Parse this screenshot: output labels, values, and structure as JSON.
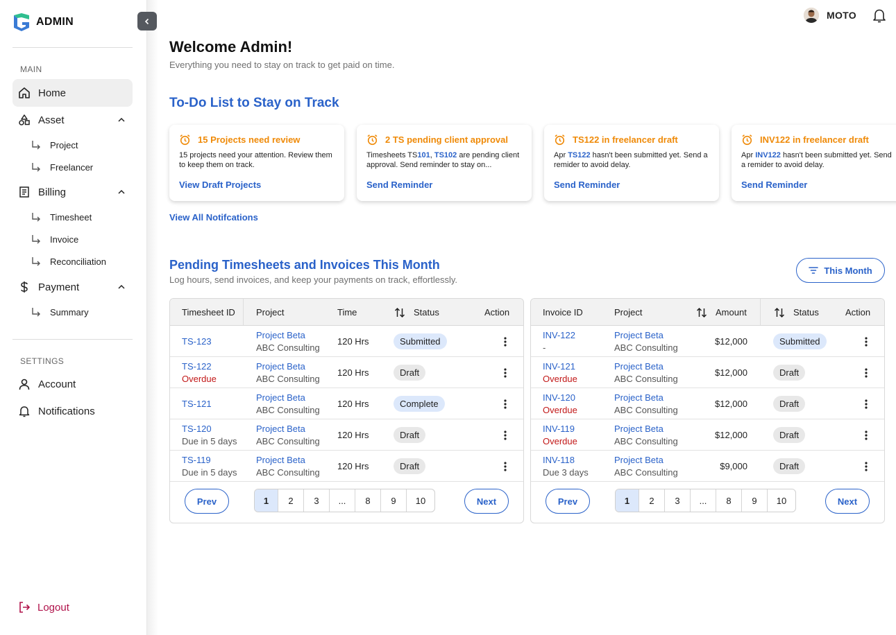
{
  "brand": {
    "name": "ADMIN"
  },
  "sidebar": {
    "main_label": "MAIN",
    "settings_label": "SETTINGS",
    "home": "Home",
    "asset": "Asset",
    "asset_items": [
      "Project",
      "Freelancer"
    ],
    "billing": "Billing",
    "billing_items": [
      "Timesheet",
      "Invoice",
      "Reconciliation"
    ],
    "payment": "Payment",
    "payment_items": [
      "Summary"
    ],
    "account": "Account",
    "notifications": "Notifications",
    "logout": "Logout"
  },
  "topbar": {
    "user_name": "MOTO"
  },
  "welcome": {
    "title": "Welcome Admin!",
    "subtitle": "Everything you need to stay on track to get paid on time."
  },
  "todo": {
    "title": "To-Do List to Stay on Track",
    "view_all": "View All Notifcations",
    "cards": [
      {
        "title": "15 Projects need review",
        "body_pre": "15 projects need your attention. Review them to keep them on track.",
        "hl1": "",
        "mid": "",
        "hl2": "",
        "body_post": "",
        "action": "View Draft Projects"
      },
      {
        "title": "2 TS pending client approval",
        "body_pre": "Timesheets TS",
        "hl1": "101",
        "mid": ", ",
        "hl2": "TS102",
        "body_post": " are pending client approval. Send reminder to stay on...",
        "action": "Send Reminder"
      },
      {
        "title": "TS122 in freelancer draft",
        "body_pre": "Apr ",
        "hl1": "TS122",
        "mid": "",
        "hl2": "",
        "body_post": " hasn't been submitted yet. Send a remider to avoid delay.",
        "action": "Send Reminder"
      },
      {
        "title": "INV122 in freelancer draft",
        "body_pre": "Apr ",
        "hl1": "INV122",
        "mid": "",
        "hl2": "",
        "body_post": " hasn't been submitted yet. Send a remider to avoid delay.",
        "action": "Send Reminder"
      }
    ]
  },
  "pending": {
    "title": "Pending Timesheets and Invoices This Month",
    "subtitle": "Log hours, send invoices, and keep your payments on track, effortlessly.",
    "filter_label": "This Month"
  },
  "timesheets": {
    "headers": {
      "id": "Timesheet ID",
      "project": "Project",
      "time": "Time",
      "status": "Status",
      "action": "Action"
    },
    "rows": [
      {
        "id": "TS-123",
        "note": "",
        "note_type": "none",
        "project": "Project Beta",
        "client": "ABC Consulting",
        "time": "120 Hrs",
        "status": "Submitted",
        "status_color": "blue"
      },
      {
        "id": "TS-122",
        "note": "Overdue",
        "note_type": "overdue",
        "project": "Project Beta",
        "client": "ABC Consulting",
        "time": "120 Hrs",
        "status": "Draft",
        "status_color": "gray"
      },
      {
        "id": "TS-121",
        "note": "",
        "note_type": "none",
        "project": "Project Beta",
        "client": "ABC Consulting",
        "time": "120 Hrs",
        "status": "Complete",
        "status_color": "blue"
      },
      {
        "id": "TS-120",
        "note": "Due in 5 days",
        "note_type": "normal",
        "project": "Project Beta",
        "client": "ABC Consulting",
        "time": "120 Hrs",
        "status": "Draft",
        "status_color": "gray"
      },
      {
        "id": "TS-119",
        "note": "Due in 5 days",
        "note_type": "normal",
        "project": "Project Beta",
        "client": "ABC Consulting",
        "time": "120 Hrs",
        "status": "Draft",
        "status_color": "gray"
      }
    ],
    "pager": {
      "prev": "Prev",
      "next": "Next",
      "pages": [
        "1",
        "2",
        "3",
        "...",
        "8",
        "9",
        "10"
      ],
      "current": "1"
    }
  },
  "invoices": {
    "headers": {
      "id": "Invoice ID",
      "project": "Project",
      "amount": "Amount",
      "status": "Status",
      "action": "Action"
    },
    "rows": [
      {
        "id": "INV-122",
        "note": "-",
        "note_type": "normal",
        "project": "Project Beta",
        "client": "ABC Consulting",
        "amount": "$12,000",
        "status": "Submitted",
        "status_color": "blue"
      },
      {
        "id": "INV-121",
        "note": "Overdue",
        "note_type": "overdue",
        "project": "Project Beta",
        "client": "ABC Consulting",
        "amount": "$12,000",
        "status": "Draft",
        "status_color": "gray"
      },
      {
        "id": "INV-120",
        "note": "Overdue",
        "note_type": "overdue",
        "project": "Project Beta",
        "client": "ABC Consulting",
        "amount": "$12,000",
        "status": "Draft",
        "status_color": "gray"
      },
      {
        "id": "INV-119",
        "note": "Overdue",
        "note_type": "overdue",
        "project": "Project Beta",
        "client": "ABC Consulting",
        "amount": "$12,000",
        "status": "Draft",
        "status_color": "gray"
      },
      {
        "id": "INV-118",
        "note": "Due 3 days",
        "note_type": "normal",
        "project": "Project Beta",
        "client": "ABC Consulting",
        "amount": "$9,000",
        "status": "Draft",
        "status_color": "gray"
      }
    ],
    "pager": {
      "prev": "Prev",
      "next": "Next",
      "pages": [
        "1",
        "2",
        "3",
        "...",
        "8",
        "9",
        "10"
      ],
      "current": "1"
    }
  },
  "colors": {
    "accent": "#2a62c9",
    "warning": "#ef8a08",
    "danger": "#c21818",
    "logout": "#b0124a",
    "badge_blue": "#dce8fb",
    "badge_gray": "#e8e8e8"
  },
  "icons": [
    "logo-icon",
    "chevron-left-icon",
    "home-icon",
    "shapes-icon",
    "document-icon",
    "dollar-icon",
    "subitem-arrow-icon",
    "chevron-up-icon",
    "user-icon",
    "bell-icon",
    "logout-icon",
    "alarm-icon",
    "filter-icon",
    "sort-icon",
    "kebab-icon"
  ]
}
